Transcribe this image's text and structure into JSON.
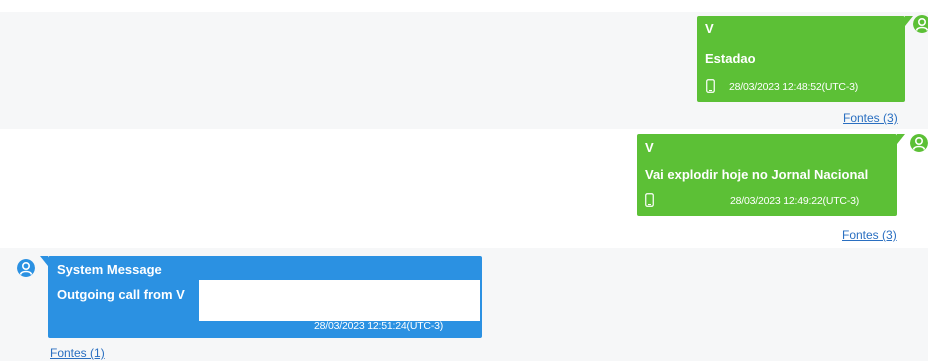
{
  "colors": {
    "outgoing_bubble": "#5cc036",
    "system_bubble": "#2b91e2",
    "link": "#2a6fc1",
    "row_alt_background": "#f6f7f8"
  },
  "messages": [
    {
      "sender": "V",
      "text": "Estadao",
      "timestamp": "28/03/2023 12:48:52(UTC-3)",
      "sources_link": "Fontes (3)",
      "device_icon": "phone-icon",
      "avatar_icon": "user-avatar-icon"
    },
    {
      "sender": "V",
      "text": "Vai explodir hoje no Jornal  Nacional",
      "timestamp": "28/03/2023 12:49:22(UTC-3)",
      "sources_link": "Fontes (3)",
      "device_icon": "phone-icon",
      "avatar_icon": "user-avatar-icon"
    },
    {
      "sender": "System Message",
      "text": "Outgoing call from V",
      "timestamp": "28/03/2023 12:51:24(UTC-3)",
      "sources_link": "Fontes (1)",
      "avatar_icon": "user-avatar-icon"
    }
  ]
}
